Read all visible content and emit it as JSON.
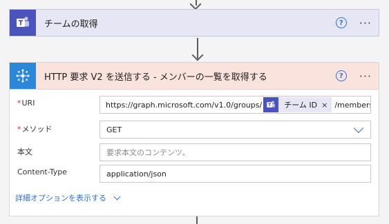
{
  "teams_card": {
    "title": "チームの取得",
    "help_glyph": "?",
    "more_glyph": "···",
    "icon": "teams-icon",
    "color": "#4b53bc"
  },
  "http_card": {
    "title": "HTTP 要求 V2 を送信する - メンバーの一覧を取得する",
    "help_glyph": "?",
    "more_glyph": "···",
    "icon": "http-webhook-icon",
    "header_color": "#fbe3dd",
    "fields": {
      "uri": {
        "label": "URI",
        "required": true,
        "prefix": "https://graph.microsoft.com/v1.0/groups/",
        "token_label": "チーム ID",
        "token_close": "×",
        "suffix": "/members"
      },
      "method": {
        "label": "メソッド",
        "required": true,
        "value": "GET"
      },
      "body": {
        "label": "本文",
        "required": false,
        "placeholder": "要求本文のコンテンツ。"
      },
      "content_type": {
        "label": "Content-Type",
        "required": false,
        "value": "application/json"
      }
    },
    "advanced_label": "詳細オプションを表示する"
  },
  "required_mark": "*"
}
